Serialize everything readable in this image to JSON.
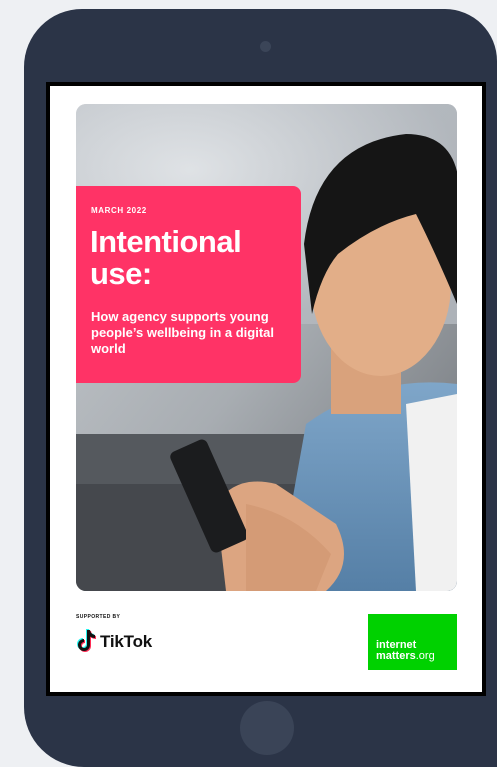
{
  "report": {
    "date": "MARCH 2022",
    "title": "Intentional use:",
    "subtitle": "How agency supports young people’s wellbeing in a digital world"
  },
  "sponsor": {
    "label": "SUPPORTED BY",
    "name": "TikTok",
    "icon": "tiktok-note-icon"
  },
  "publisher": {
    "logo_line1": "internet",
    "logo_line2": "matters",
    "logo_suffix": ".org",
    "logo_color": "#00d100"
  },
  "colors": {
    "device_frame": "#2b3447",
    "title_card": "#ff3366",
    "background": "#eef0f3"
  }
}
